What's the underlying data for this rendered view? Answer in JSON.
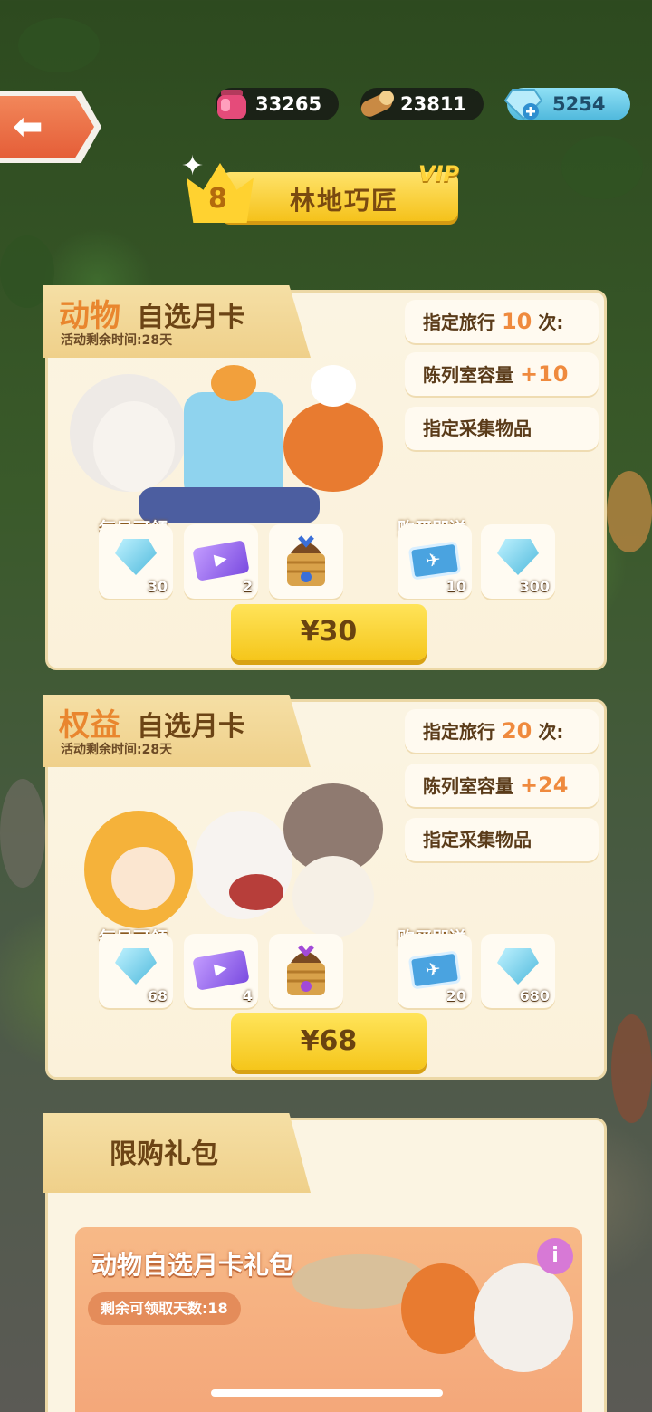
{
  "resources": {
    "ink": "33265",
    "wood": "23811",
    "gems": "5254"
  },
  "vip": {
    "level": "8",
    "title": "林地巧匠",
    "badge": "VIP"
  },
  "cards": [
    {
      "title_highlight": "动物",
      "title_rest": "自选月卡",
      "remaining": "活动剩余时间:28天",
      "perks": {
        "travel_prefix": "指定旅行",
        "travel_value": "10",
        "travel_suffix": "次:",
        "gallery_prefix": "陈列室容量",
        "gallery_value": "+10",
        "collect": "指定采集物品"
      },
      "daily_label": "每日可领",
      "bonus_label": "购买即送",
      "daily_items": [
        {
          "icon": "gem-icon",
          "count": "30"
        },
        {
          "icon": "video-ticket-icon",
          "count": "2"
        },
        {
          "icon": "basket-icon",
          "count": ""
        }
      ],
      "bonus_items": [
        {
          "icon": "travel-ticket-icon",
          "count": "10"
        },
        {
          "icon": "gem-icon",
          "count": "300"
        }
      ],
      "price": "¥30"
    },
    {
      "title_highlight": "权益",
      "title_rest": "自选月卡",
      "remaining": "活动剩余时间:28天",
      "perks": {
        "travel_prefix": "指定旅行",
        "travel_value": "20",
        "travel_suffix": "次:",
        "gallery_prefix": "陈列室容量",
        "gallery_value": "+24",
        "collect": "指定采集物品"
      },
      "daily_label": "每日可领",
      "bonus_label": "购买即送",
      "daily_items": [
        {
          "icon": "gem-icon",
          "count": "68"
        },
        {
          "icon": "video-ticket-icon",
          "count": "4"
        },
        {
          "icon": "basket-icon",
          "count": ""
        }
      ],
      "bonus_items": [
        {
          "icon": "travel-ticket-icon",
          "count": "20"
        },
        {
          "icon": "gem-icon",
          "count": "680"
        }
      ],
      "price": "¥68"
    }
  ],
  "packs": {
    "title": "限购礼包",
    "pack_title": "动物自选月卡礼包",
    "days_left": "剩余可领取天数:18",
    "info": "i"
  },
  "colors": {
    "accent_orange": "#ef8a3e",
    "button_yellow": "#f5c61b",
    "card_bg": "#fbf4e2"
  }
}
